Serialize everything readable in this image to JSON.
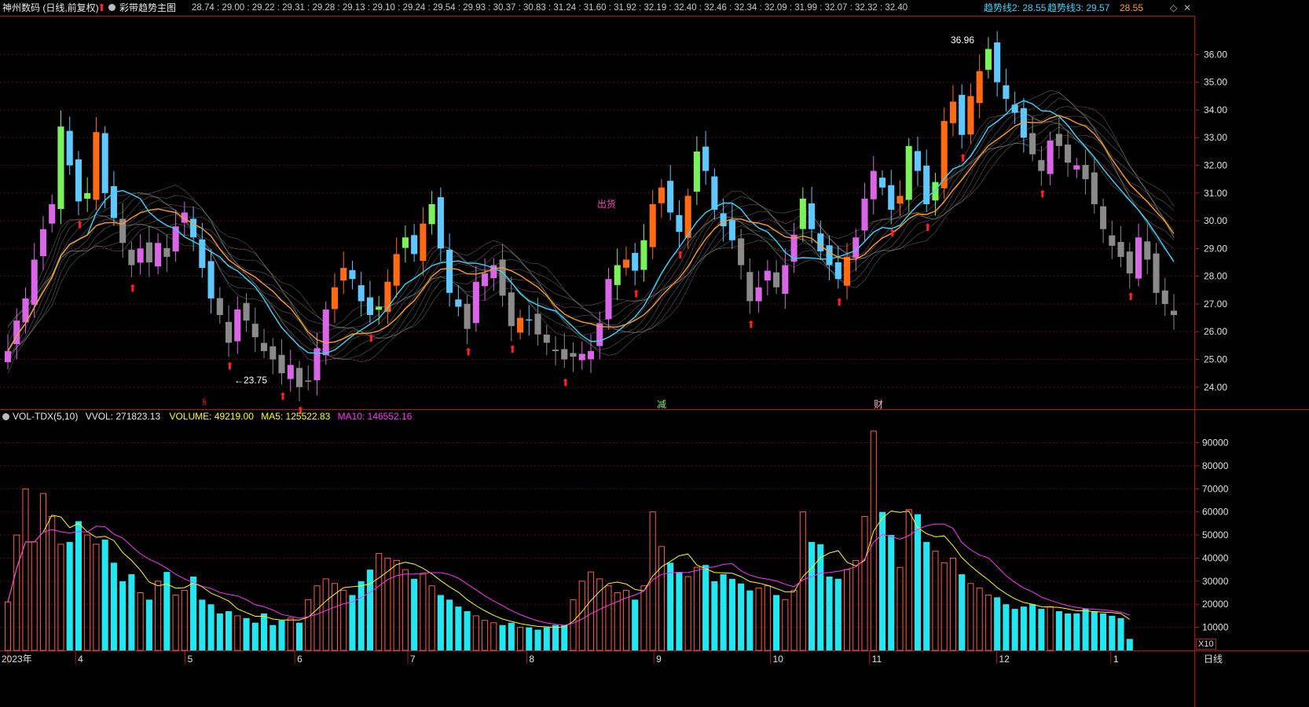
{
  "header": {
    "stock_name": "神州数码 (日线,前复权)",
    "indicator_name": "彩带趋势主图",
    "ribbon_values": "28.74 : 29.00 : 29.22 : 29.31 : 29.28 : 29.13 : 29.10 : 29.24 : 29.54 : 29.93 : 30.37 : 30.83 : 31.24 : 31.60 : 31.92 : 32.19 : 32.40 : 32.46 : 32.34 : 32.09 : 31.99 : 32.07 : 32.32 : 32.40",
    "trend2_label": "趋势线2: 28.55",
    "trend3_label": "趋势线3: 29.57",
    "trend_extra": "28.55",
    "icons": [
      "diamond-icon",
      "close-icon"
    ]
  },
  "main_chart": {
    "y_ticks": [
      "36.00",
      "35.00",
      "34.00",
      "33.00",
      "32.00",
      "31.00",
      "30.00",
      "29.00",
      "28.00",
      "27.00",
      "26.00",
      "25.00",
      "24.00"
    ],
    "y_range": [
      23.2,
      37.4
    ],
    "high_label": "36.96",
    "low_label": "←23.75",
    "annotation_out": "出货",
    "event_markers": [
      "减",
      "财"
    ],
    "colors": {
      "orange": "#ff6a13",
      "green": "#7cf25a",
      "magenta": "#d966e6",
      "blue": "#5ec8ff",
      "gray": "#8a8a8a",
      "arrow": "#ff2020",
      "ribbon": "#8c8c8c"
    }
  },
  "volume_panel": {
    "title": "VOL-TDX(5,10)",
    "vvol": "VVOL: 271823.13",
    "volume": "VOLUME: 49219.00",
    "ma5": "MA5: 125522.83",
    "ma10": "MA10: 146552.16",
    "y_ticks": [
      "90000",
      "80000",
      "70000",
      "60000",
      "50000",
      "40000",
      "30000",
      "20000",
      "10000"
    ],
    "unit": "X10"
  },
  "x_axis": {
    "labels": [
      "2023年",
      "4",
      "5",
      "6",
      "7",
      "8",
      "9",
      "10",
      "11",
      "12",
      "1"
    ],
    "period": "日线"
  },
  "chart_data": {
    "type": "candlestick",
    "price_closes": [
      25.3,
      26.4,
      27.2,
      28.6,
      29.7,
      30.6,
      33.4,
      32.0,
      30.7,
      31.0,
      33.2,
      31.0,
      30.1,
      29.2,
      28.4,
      29.0,
      28.5,
      29.2,
      28.7,
      29.8,
      30.3,
      29.4,
      28.3,
      27.2,
      26.6,
      25.6,
      26.8,
      26.4,
      25.8,
      25.3,
      25.0,
      24.5,
      24.8,
      24.0,
      24.2,
      25.4,
      26.8,
      27.6,
      28.3,
      27.9,
      27.1,
      26.6,
      26.9,
      27.8,
      28.8,
      29.4,
      28.8,
      29.9,
      30.6,
      29.0,
      27.4,
      26.9,
      26.1,
      27.8,
      28.1,
      28.4,
      27.3,
      26.2,
      26.5,
      26.4,
      25.9,
      25.6,
      25.3,
      25.0,
      25.1,
      25.2,
      25.3,
      26.3,
      27.9,
      28.4,
      28.6,
      28.2,
      29.3,
      30.6,
      31.2,
      30.3,
      29.6,
      30.9,
      32.5,
      31.8,
      30.4,
      29.8,
      29.3,
      28.4,
      27.1,
      27.6,
      28.2,
      27.6,
      28.4,
      29.5,
      30.8,
      29.7,
      28.9,
      28.4,
      27.9,
      28.7,
      29.4,
      30.8,
      31.8,
      31.2,
      30.4,
      30.9,
      32.7,
      31.8,
      30.6,
      31.4,
      33.6,
      34.3,
      33.1,
      34.5,
      35.4,
      36.2,
      35.0,
      34.4,
      33.9,
      33.0,
      32.4,
      31.8,
      32.9,
      32.7,
      32.1,
      32.0,
      31.5,
      30.6,
      29.7,
      29.1,
      28.7,
      28.1,
      29.4,
      28.6,
      27.4,
      27.0,
      26.6
    ],
    "volumes": [
      21000,
      50000,
      70000,
      47000,
      68000,
      58000,
      46000,
      47000,
      56000,
      50000,
      46000,
      48000,
      38000,
      30000,
      33000,
      25000,
      22000,
      30000,
      34000,
      24000,
      26000,
      32000,
      22000,
      20000,
      16000,
      17000,
      15000,
      14000,
      12000,
      16000,
      11000,
      13000,
      14000,
      12000,
      22000,
      28000,
      31000,
      29000,
      26000,
      24000,
      30000,
      35000,
      42000,
      40000,
      39000,
      35000,
      31000,
      33000,
      28000,
      24000,
      22000,
      19000,
      17000,
      15000,
      13000,
      12000,
      11000,
      12000,
      10000,
      10000,
      9000,
      10000,
      11000,
      11000,
      22000,
      30000,
      34000,
      31000,
      28000,
      25000,
      26000,
      22000,
      28000,
      60000,
      45000,
      38000,
      34000,
      32000,
      36000,
      37000,
      30000,
      33000,
      31000,
      29000,
      26000,
      27000,
      28000,
      24000,
      22000,
      26000,
      60000,
      47000,
      46000,
      32000,
      31000,
      35000,
      39000,
      58000,
      95000,
      60000,
      50000,
      36000,
      61000,
      59000,
      47000,
      43000,
      38000,
      40000,
      33000,
      29000,
      27000,
      24000,
      23000,
      20000,
      18000,
      19000,
      20000,
      18000,
      19000,
      17000,
      16000,
      16000,
      18000,
      17000,
      16000,
      15000,
      14000,
      5000
    ],
    "series": [
      {
        "name": "MA5"
      },
      {
        "name": "MA10"
      }
    ]
  }
}
